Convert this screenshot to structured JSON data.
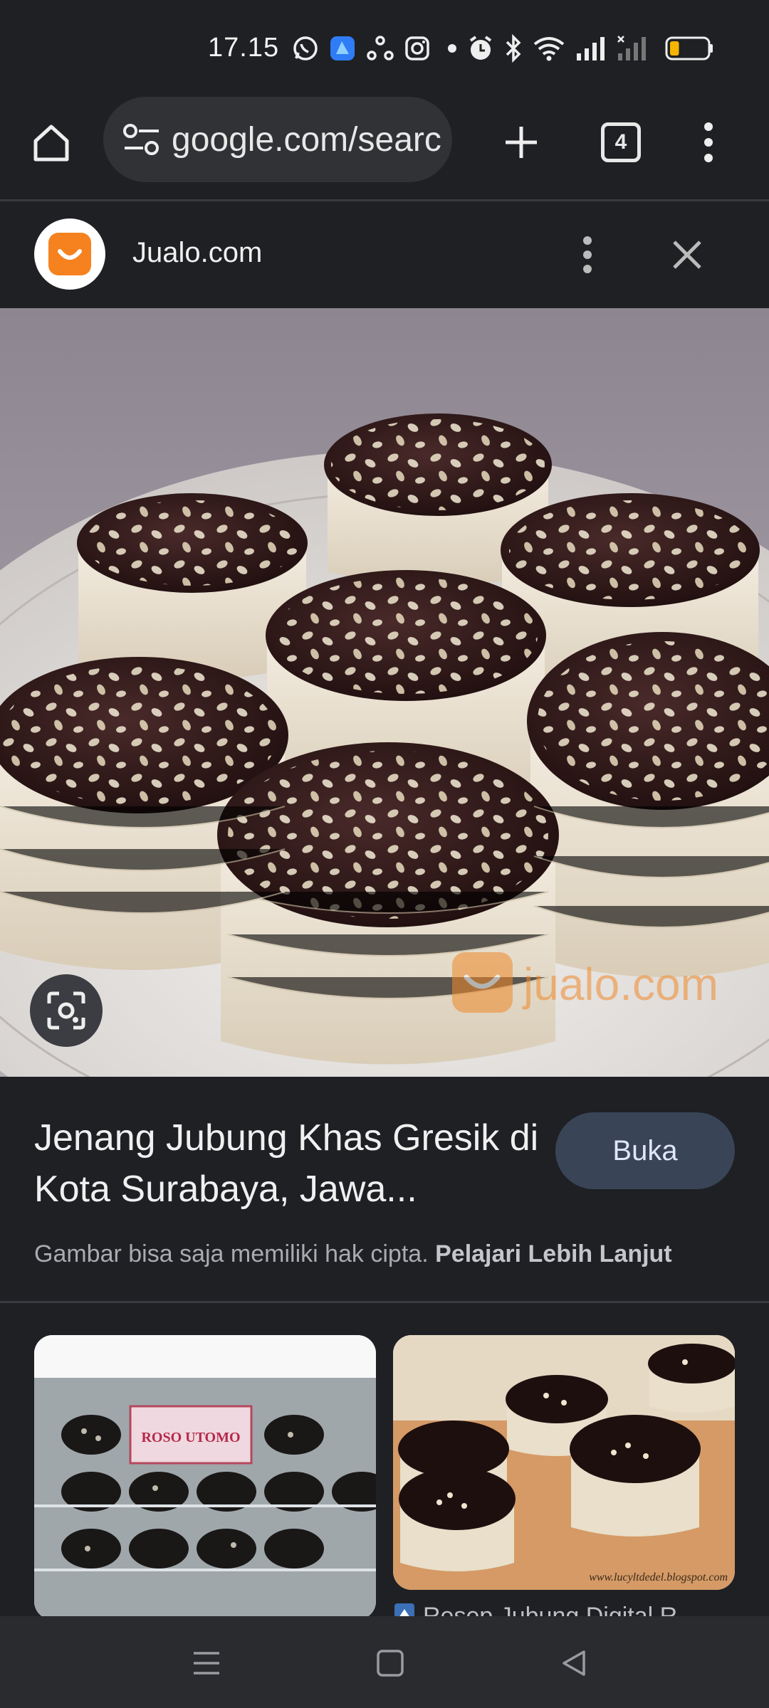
{
  "status_bar": {
    "time": "17.15",
    "icons": [
      "whatsapp-icon",
      "app-icon",
      "sync-icon",
      "instagram-icon",
      "dot-icon",
      "alarm-icon",
      "bluetooth-icon",
      "wifi-icon",
      "signal-icon",
      "signal-nodata-icon",
      "battery-icon"
    ],
    "battery_level_fraction": 0.25,
    "battery_color": "#f5b400"
  },
  "browser": {
    "url": "google.com/search",
    "tab_count": "4"
  },
  "source": {
    "site_name": "Jualo.com",
    "brand_color": "#f5821f"
  },
  "result": {
    "title": "Jenang Jubung Khas Gresik di Kota Surabaya, Jawa...",
    "open_label": "Buka",
    "copyright_text": "Gambar bisa saja memiliki hak cipta.",
    "learn_more_label": "Pelajari Lebih Lanjut"
  },
  "hero_image": {
    "watermark": "jualo.com"
  },
  "related": {
    "thumb1_label_line1": "ROSO UTOMO",
    "thumb2_watermark": "www.lucyltdedel.blogspot.com",
    "thumb2_caption": "Resep Jubung Digital R..."
  },
  "nav_bar": {
    "icons": [
      "recents-icon",
      "home-icon",
      "back-icon"
    ]
  }
}
